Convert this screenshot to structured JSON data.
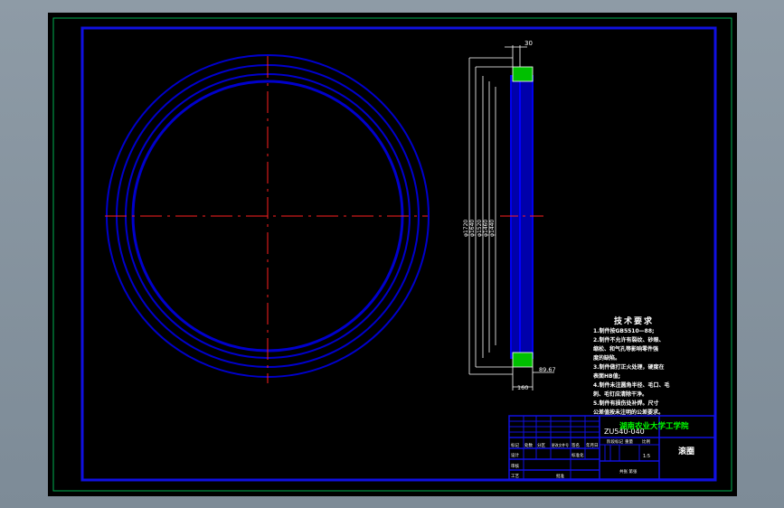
{
  "drawing": {
    "dimensions": {
      "top_width": "30",
      "dia_outer": "φ1720",
      "dia_2": "φ1640",
      "dia_3": "φ1520",
      "dia_4": "φ1460",
      "dia_inner": "φ1440",
      "right_dim": "89.67",
      "bottom_width": "160"
    },
    "tech_requirements": {
      "title": "技术要求",
      "lines": [
        "1.制件按GB5510—88;",
        "2.制件不允许有裂纹、砂眼、",
        "缩松、和气孔等影响零件强",
        "度的缺陷。",
        "3.制件做打正火处理，硬度在",
        "表面HB值;",
        "4.制件未注圆角半径、毛口、毛",
        "刺、毛钉应清除干净。",
        "5.制件有损伤处补焊。尺寸",
        "公差值按未注明的公差要求。"
      ]
    },
    "title_block": {
      "part_number": "ZU540-040",
      "school": "湖南农业大学工学院",
      "part_name": "滚圈",
      "scale": "1:5",
      "hdr_material": "阶段标记",
      "hdr_weight": "重量",
      "hdr_scale": "比例",
      "row_labels": [
        "标记",
        "处数",
        "分区",
        "更改文件号",
        "签名",
        "年月日"
      ],
      "role_design": "设计",
      "role_std": "标准化",
      "role_check": "审核",
      "role_process": "工艺",
      "role_approve": "批准",
      "sheet_text": "共张 第张"
    }
  },
  "colors": {
    "background": "#000000",
    "frame": "#0000d8",
    "outer_frame": "#00b050",
    "centerline": "#ff2020",
    "dimension": "#ffffff",
    "hatch": "#00d000",
    "title": "#00ff00"
  }
}
